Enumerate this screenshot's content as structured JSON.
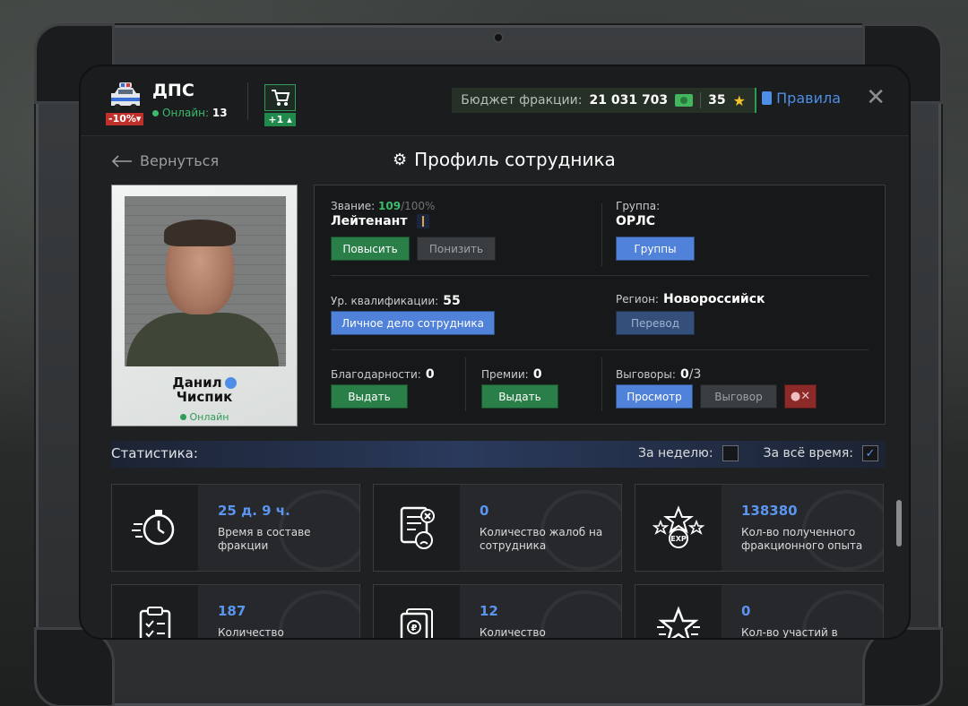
{
  "header": {
    "faction_name": "ДПС",
    "discount": "-10%",
    "online_label": "Онлайн:",
    "online_count": "13",
    "cart_badge": "+1",
    "budget_label": "Бюджет фракции:",
    "budget_value": "21 031 703",
    "stars_value": "35",
    "rules_label": "Правила",
    "close_glyph": "✕"
  },
  "nav": {
    "back_label": "Вернуться",
    "title": "Профиль сотрудника"
  },
  "employee": {
    "first_name": "Данил",
    "last_name": "Чиспик",
    "status": "Онлайн"
  },
  "info": {
    "rank_label": "Звание:",
    "rank_progress": "109",
    "rank_progress_suffix": "/100%",
    "rank_name": "Лейтенант",
    "promote_label": "Повысить",
    "demote_label": "Понизить",
    "group_label": "Группа:",
    "group_name": "ОРЛС",
    "groups_button": "Группы",
    "qual_label": "Ур. квалификации:",
    "qual_value": "55",
    "personal_file_button": "Личное дело сотрудника",
    "region_label": "Регион:",
    "region_value": "Новороссийск",
    "transfer_button": "Перевод",
    "thanks_label": "Благодарности:",
    "thanks_value": "0",
    "thanks_button": "Выдать",
    "bonus_label": "Премии:",
    "bonus_value": "0",
    "bonus_button": "Выдать",
    "reprimand_label": "Выговоры:",
    "reprimand_value": "0",
    "reprimand_max": "/3",
    "view_button": "Просмотр",
    "reprimand_button": "Выговор"
  },
  "stats": {
    "title": "Статистика:",
    "week_label": "За неделю:",
    "alltime_label": "За всё время:",
    "cards": [
      {
        "icon": "stopwatch-icon",
        "value": "25 д. 9 ч.",
        "label": "Время в составе фракции"
      },
      {
        "icon": "complaint-icon",
        "value": "0",
        "label": "Количество жалоб на сотрудника"
      },
      {
        "icon": "exp-stars-icon",
        "value": "138380",
        "label": "Кол-во полученного фракционного опыта"
      },
      {
        "icon": "clipboard-icon",
        "value": "187",
        "label": "Количество"
      },
      {
        "icon": "money-doc-icon",
        "value": "12",
        "label": "Количество"
      },
      {
        "icon": "star-icon",
        "value": "0",
        "label": "Кол-во участий в"
      }
    ]
  },
  "colors": {
    "accent_green": "#3dbb6c",
    "accent_blue": "#4f82d8",
    "danger_red": "#8c2a2a"
  }
}
